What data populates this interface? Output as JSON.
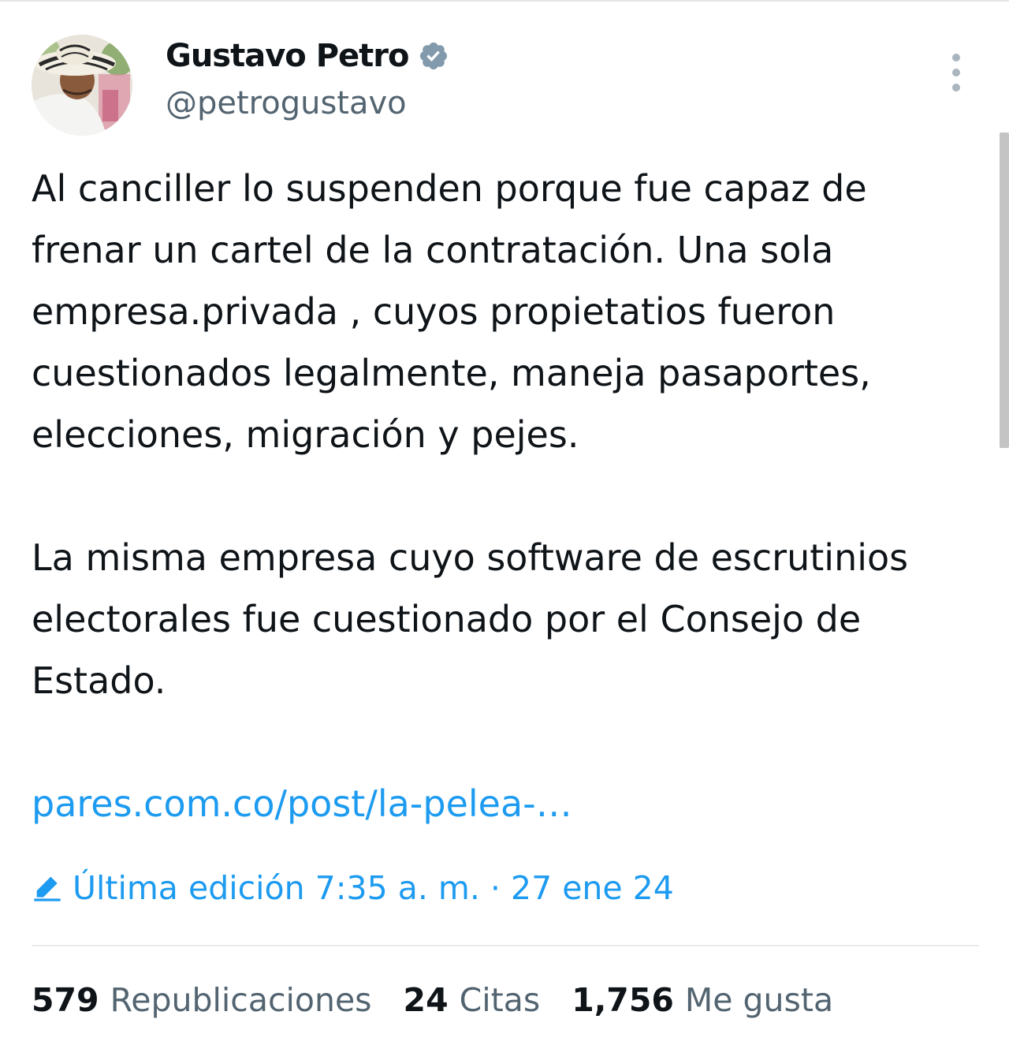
{
  "author": {
    "display_name": "Gustavo Petro",
    "handle": "@petrogustavo",
    "verified": true
  },
  "tweet": {
    "paragraph_1": "Al canciller lo suspenden porque fue capaz de frenar un cartel de la contratación. Una sola empresa.privada , cuyos propietatios fueron cuestionados legalmente, maneja pasaportes, elecciones, migración y pejes.",
    "paragraph_2": "La misma empresa cuyo software de escrutinios electorales fue cuestionado por el Consejo de Estado.",
    "link_text": "pares.com.co/post/la-pelea-…"
  },
  "edit_info": {
    "text": "Última edición 7:35 a. m. · 27 ene 24"
  },
  "stats": {
    "reposts_value": "579",
    "reposts_label": "Republicaciones",
    "quotes_value": "24",
    "quotes_label": "Citas",
    "likes_value": "1,756",
    "likes_label": "Me gusta"
  },
  "colors": {
    "link": "#1d9bf0",
    "secondary_text": "#536471",
    "primary_text": "#0f1419",
    "verified_badge": "#829aab"
  },
  "icons": {
    "verified": "verified-badge-icon",
    "more": "more-options-icon",
    "edit": "pencil-edit-icon"
  }
}
